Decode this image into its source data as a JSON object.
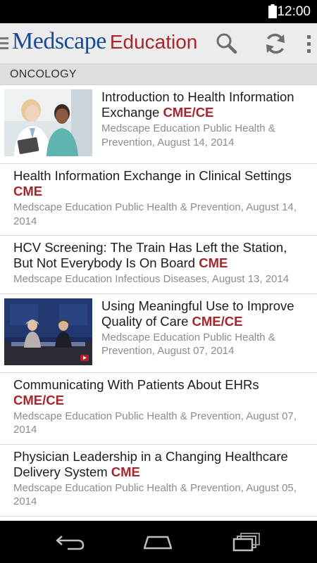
{
  "status_bar": {
    "time": "12:00"
  },
  "app_bar": {
    "brand": "Medscape",
    "brand_suffix": "Education"
  },
  "section": {
    "label": "ONCOLOGY"
  },
  "articles": [
    {
      "has_thumbnail": true,
      "thumbnail": "doctor-and-nurse-with-tablet-photo",
      "title": "Introduction to Health Information Exchange ",
      "badge": "CME/CE",
      "meta": "Medscape Education Public Health & Prevention, August 14, 2014"
    },
    {
      "has_thumbnail": false,
      "title": "Health Information Exchange in Clinical Settings ",
      "badge": "CME",
      "meta": "Medscape Education Public Health & Prevention, August 14, 2014"
    },
    {
      "has_thumbnail": false,
      "title": "HCV Screening: The Train Has Left the Station, But Not Everybody Is On Board ",
      "badge": "CME",
      "meta": "Medscape Education Infectious Diseases, August 13, 2014"
    },
    {
      "has_thumbnail": true,
      "thumbnail": "video-interview-studio-photo",
      "title": "Using Meaningful Use to Improve Quality of Care ",
      "badge": "CME/CE",
      "meta": "Medscape Education Public Health & Prevention, August 07, 2014"
    },
    {
      "has_thumbnail": false,
      "title": "Communicating With Patients About EHRs ",
      "badge": "CME/CE",
      "meta": "Medscape Education Public Health & Prevention, August 07, 2014"
    },
    {
      "has_thumbnail": false,
      "title": "Physician Leadership in a Changing Healthcare Delivery System ",
      "badge": "CME",
      "meta": "Medscape Education Public Health & Prevention, August 05, 2014"
    }
  ],
  "icons": {
    "search": "search-icon",
    "refresh": "refresh-icon",
    "overflow": "overflow-menu-icon",
    "back": "back-icon",
    "home": "home-icon",
    "recents": "recent-apps-icon"
  },
  "colors": {
    "brand_blue": "#1a4a94",
    "accent_red": "#a6262d",
    "meta_gray": "#8c8c8c"
  }
}
